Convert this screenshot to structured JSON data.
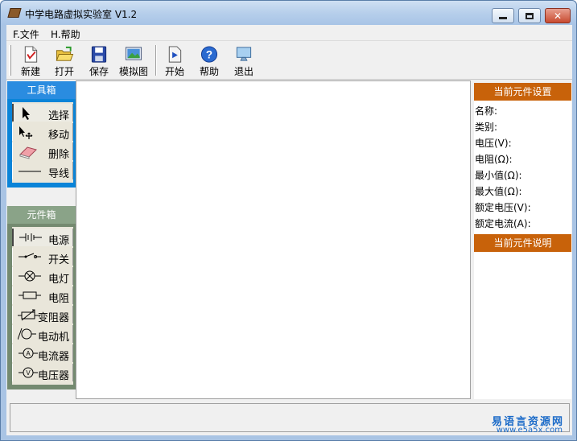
{
  "window": {
    "title": "中学电路虚拟实验室 V1.2"
  },
  "menu": [
    "F.文件",
    "H.帮助"
  ],
  "toolbar": {
    "new": "新建",
    "open": "打开",
    "save": "保存",
    "simulate": "模拟图",
    "start": "开始",
    "help": "帮助",
    "exit": "退出"
  },
  "toolbox": {
    "title": "工具箱",
    "items": [
      "选择",
      "移动",
      "删除",
      "导线"
    ]
  },
  "components": {
    "title": "元件箱",
    "items": [
      "电源",
      "开关",
      "电灯",
      "电阻",
      "变阻器",
      "电动机",
      "电流器",
      "电压器"
    ]
  },
  "properties": {
    "title": "当前元件设置",
    "rows": [
      "名称:",
      "类别:",
      "电压(V):",
      "电阻(Ω):",
      "最小值(Ω):",
      "最大值(Ω):",
      "额定电压(V):",
      "额定电流(A):"
    ],
    "desc_title": "当前元件说明"
  },
  "watermark": {
    "line1": "易语言资源网",
    "line2": "www.e5a5x.com"
  },
  "colors": {
    "toolbox": "#0a84d8",
    "components": "#748a70",
    "properties": "#c8620a"
  }
}
